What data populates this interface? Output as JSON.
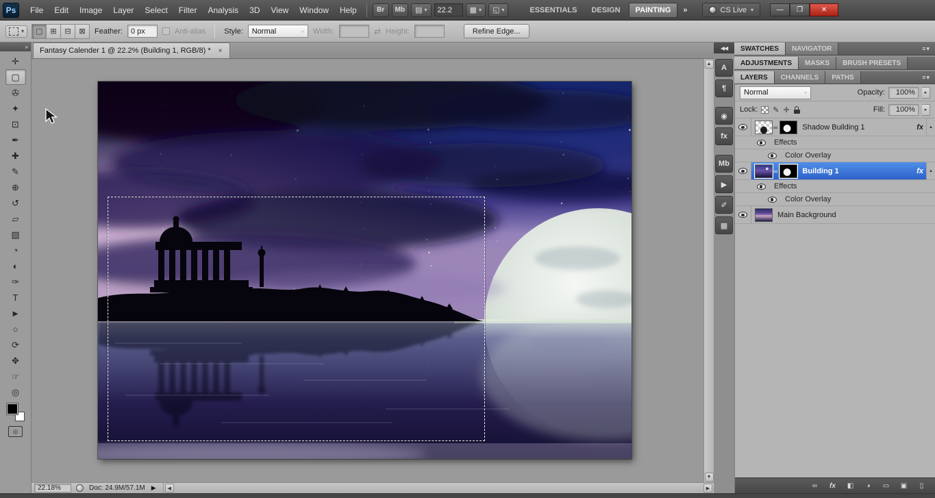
{
  "app": {
    "logo": "Ps",
    "menus": [
      "File",
      "Edit",
      "Image",
      "Layer",
      "Select",
      "Filter",
      "Analysis",
      "3D",
      "View",
      "Window",
      "Help"
    ],
    "bridge_button": "Br",
    "minibridge_button": "Mb",
    "zoom_field": "22.2",
    "workspaces": [
      "ESSENTIALS",
      "DESIGN",
      "PAINTING"
    ],
    "workspace_overflow": "»",
    "cs_live_label": "CS Live",
    "window_buttons": {
      "minimize": "—",
      "restore": "❐",
      "close": "✕"
    }
  },
  "options": {
    "feather_label": "Feather:",
    "feather_value": "0 px",
    "antialias_label": "Anti-alias",
    "style_label": "Style:",
    "style_value": "Normal",
    "width_label": "Width:",
    "height_label": "Height:",
    "swap_glyph": "⇄",
    "refine_edge_label": "Refine Edge...",
    "mode_glyphs": [
      "▢",
      "⊞",
      "⊟",
      "⊠"
    ]
  },
  "tools": [
    {
      "name": "move-tool",
      "glyph": "✛"
    },
    {
      "name": "rectangular-marquee-tool",
      "glyph": "▢",
      "selected": true
    },
    {
      "name": "lasso-tool",
      "glyph": "✇"
    },
    {
      "name": "quick-selection-tool",
      "glyph": "✦"
    },
    {
      "name": "crop-tool",
      "glyph": "⊡"
    },
    {
      "name": "eyedropper-tool",
      "glyph": "✒"
    },
    {
      "name": "spot-healing-brush-tool",
      "glyph": "✚"
    },
    {
      "name": "brush-tool",
      "glyph": "✎"
    },
    {
      "name": "clone-stamp-tool",
      "glyph": "⊕"
    },
    {
      "name": "history-brush-tool",
      "glyph": "↺"
    },
    {
      "name": "eraser-tool",
      "glyph": "▱"
    },
    {
      "name": "gradient-tool",
      "glyph": "▧"
    },
    {
      "name": "blur-tool",
      "glyph": "◔"
    },
    {
      "name": "dodge-tool",
      "glyph": "◐"
    },
    {
      "name": "pen-tool",
      "glyph": "✑"
    },
    {
      "name": "type-tool",
      "glyph": "T"
    },
    {
      "name": "path-selection-tool",
      "glyph": "►"
    },
    {
      "name": "ellipse-tool",
      "glyph": "○"
    },
    {
      "name": "rotate-3d-tool",
      "glyph": "⟳"
    },
    {
      "name": "pan-3d-tool",
      "glyph": "✥"
    },
    {
      "name": "hand-tool",
      "glyph": "☞"
    },
    {
      "name": "zoom-tool",
      "glyph": "◎"
    }
  ],
  "document": {
    "tab_title": "Fantasy Calender 1 @ 22.2% (Building 1, RGB/8) *",
    "close_glyph": "×"
  },
  "status": {
    "zoom": "22.18%",
    "doc_info": "Doc: 24.9M/57.1M",
    "play_glyph": "▶"
  },
  "dock": {
    "icon_panels": [
      {
        "name": "character-panel",
        "glyph": "A"
      },
      {
        "name": "paragraph-panel",
        "glyph": "¶"
      },
      {
        "name": "clone-source-panel",
        "glyph": "◉"
      },
      {
        "name": "layer-styles-panel",
        "glyph": "fx"
      },
      {
        "name": "mini-bridge-panel",
        "glyph": "Mb"
      },
      {
        "name": "actions-panel",
        "glyph": "▶"
      },
      {
        "name": "tool-presets-panel",
        "glyph": "✐"
      },
      {
        "name": "histogram-panel",
        "glyph": "▦"
      }
    ],
    "tab_group_1": [
      "SWATCHES",
      "NAVIGATOR"
    ],
    "tab_group_2": [
      "ADJUSTMENTS",
      "MASKS",
      "BRUSH PRESETS"
    ],
    "tab_group_3": [
      "LAYERS",
      "CHANNELS",
      "PATHS"
    ]
  },
  "layers_panel": {
    "blend_mode": "Normal",
    "opacity_label": "Opacity:",
    "opacity_value": "100%",
    "lock_label": "Lock:",
    "fill_label": "Fill:",
    "fill_value": "100%",
    "rows": [
      {
        "name": "Shadow Building 1",
        "fx": "fx"
      },
      {
        "name": "Effects"
      },
      {
        "name": "Color Overlay"
      },
      {
        "name": "Building 1",
        "fx": "fx"
      },
      {
        "name": "Effects"
      },
      {
        "name": "Color Overlay"
      },
      {
        "name": "Main Background"
      }
    ],
    "bottom_buttons": [
      {
        "name": "link-layers-button",
        "glyph": "∞"
      },
      {
        "name": "add-layer-style-button",
        "glyph": "fx"
      },
      {
        "name": "add-layer-mask-button",
        "glyph": "◧"
      },
      {
        "name": "new-adjustment-layer-button",
        "glyph": "◑"
      },
      {
        "name": "new-group-button",
        "glyph": "▭"
      },
      {
        "name": "new-layer-button",
        "glyph": "▣"
      },
      {
        "name": "delete-layer-button",
        "glyph": "▯"
      }
    ]
  },
  "colors": {
    "selected_layer_blue": "#2f6fd2",
    "close_button_red": "#b3291f",
    "canvas_bg_gray": "#9a9a9a"
  }
}
